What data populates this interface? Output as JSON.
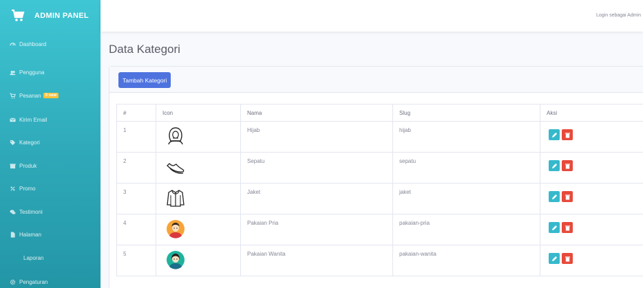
{
  "brand": {
    "title": "ADMIN PANEL",
    "icon": "cart-icon"
  },
  "topbar": {
    "login_text": "Login sebagai Admin"
  },
  "sidebar": {
    "items": [
      {
        "label": "Dashboard",
        "icon": "dashboard-icon"
      },
      {
        "label": "Pengguna",
        "icon": "users-icon"
      },
      {
        "label": "Pesanan",
        "icon": "cart-icon",
        "badge": "0 new"
      },
      {
        "label": "Kirim Email",
        "icon": "envelope-icon"
      },
      {
        "label": "Kategori",
        "icon": "tag-icon"
      },
      {
        "label": "Produk",
        "icon": "box-icon"
      },
      {
        "label": "Promo",
        "icon": "percent-icon"
      },
      {
        "label": "Testimoni",
        "icon": "comments-icon"
      },
      {
        "label": "Halaman",
        "icon": "file-icon"
      },
      {
        "label": "Laporan",
        "icon": ""
      },
      {
        "label": "Pengaturan",
        "icon": "gear-icon"
      }
    ]
  },
  "page": {
    "title": "Data Kategori",
    "add_button": "Tambah Kategori"
  },
  "table": {
    "headers": [
      "#",
      "Icon",
      "Nama",
      "Slug",
      "Aksi"
    ],
    "rows": [
      {
        "no": "1",
        "icon": "hijab-icon",
        "nama": "Hijab",
        "slug": "hijab"
      },
      {
        "no": "2",
        "icon": "shoe-icon",
        "nama": "Sepatu",
        "slug": "sepatu"
      },
      {
        "no": "3",
        "icon": "jacket-icon",
        "nama": "Jaket",
        "slug": "jaket"
      },
      {
        "no": "4",
        "icon": "man-avatar-icon",
        "nama": "Pakaian Pria",
        "slug": "pakaian-pria"
      },
      {
        "no": "5",
        "icon": "woman-avatar-icon",
        "nama": "Pakaian Wanita",
        "slug": "pakaian-wanita"
      }
    ]
  },
  "colors": {
    "sidebar": "#36b9cc",
    "primary": "#4e73df",
    "edit": "#36b9cc",
    "delete": "#e74a3b",
    "badge": "#f6c23e"
  }
}
